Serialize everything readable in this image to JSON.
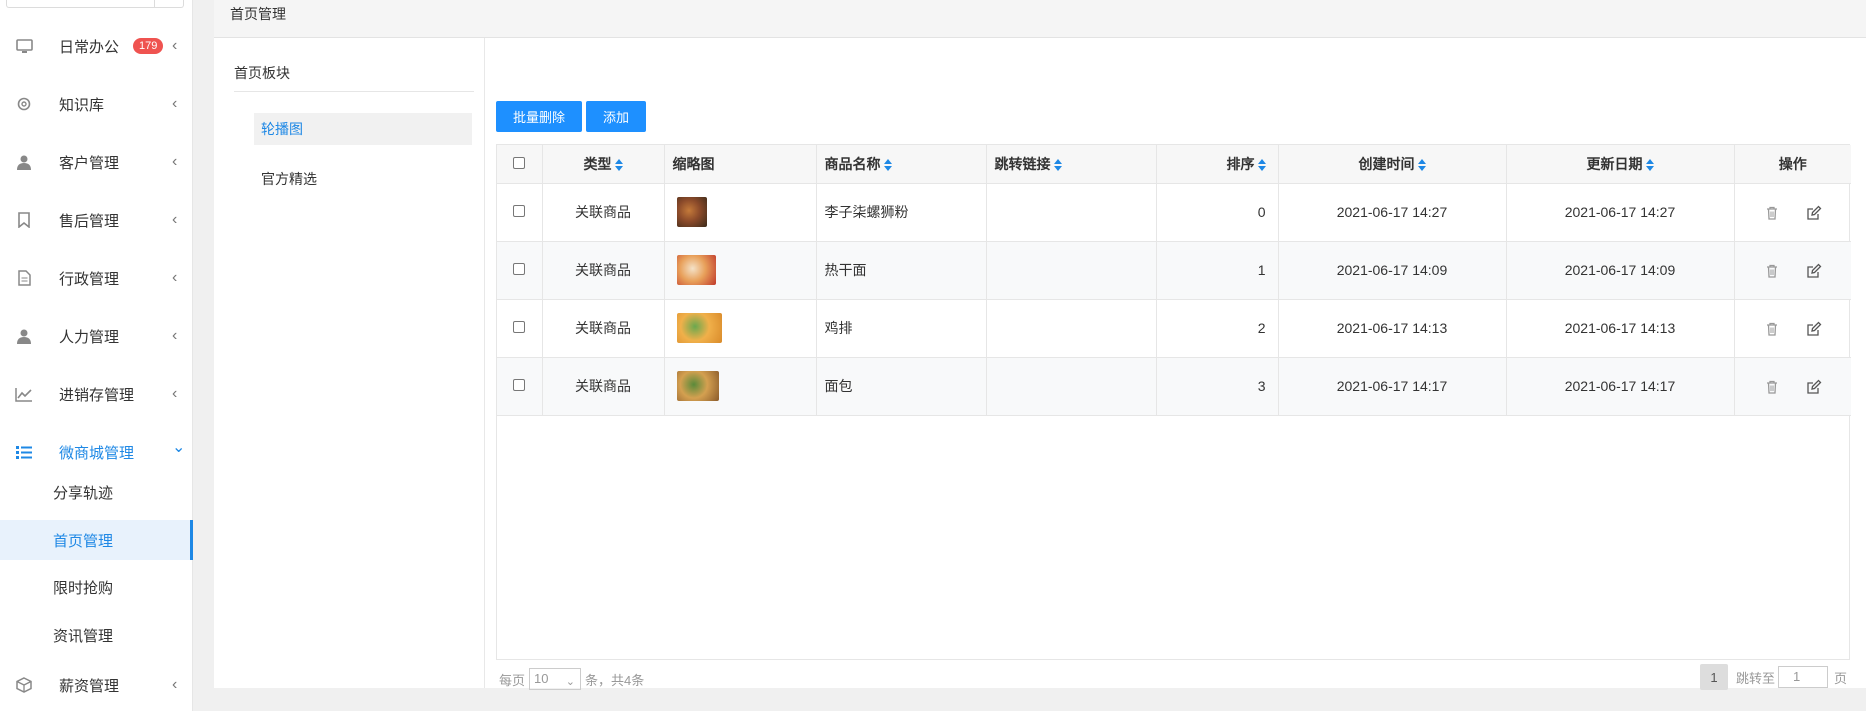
{
  "sidebar": {
    "menu": [
      {
        "label": "日常办公",
        "icon": "monitor-icon",
        "badge": "179"
      },
      {
        "label": "知识库",
        "icon": "gear-icon"
      },
      {
        "label": "客户管理",
        "icon": "user-icon"
      },
      {
        "label": "售后管理",
        "icon": "bookmark-icon"
      },
      {
        "label": "行政管理",
        "icon": "document-icon"
      },
      {
        "label": "人力管理",
        "icon": "user-icon"
      },
      {
        "label": "进销存管理",
        "icon": "line-chart-icon"
      },
      {
        "label": "微商城管理",
        "icon": "list-icon"
      },
      {
        "label": "薪资管理",
        "icon": "box-icon"
      }
    ],
    "submenu": [
      "分享轨迹",
      "首页管理",
      "限时抢购",
      "资讯管理"
    ],
    "chevron_closed": "‹",
    "chevron_open": "⌄"
  },
  "topbar": {
    "title": "首页管理"
  },
  "left_panel": {
    "title": "首页板块",
    "items": [
      "轮播图",
      "官方精选"
    ]
  },
  "toolbar": {
    "batch_delete": "批量删除",
    "add": "添加"
  },
  "table": {
    "headers": [
      "类型",
      "缩略图",
      "商品名称",
      "跳转链接",
      "排序",
      "创建时间",
      "更新日期",
      "操作"
    ],
    "rows": [
      {
        "type": "关联商品",
        "name": "李子柒螺狮粉",
        "link": "",
        "order": "0",
        "created": "2021-06-17 14:27",
        "updated": "2021-06-17 14:27",
        "thumb_colors": [
          "#3a2a1a",
          "#8b4a2a",
          "#c47a3a"
        ]
      },
      {
        "type": "关联商品",
        "name": "热干面",
        "link": "",
        "order": "1",
        "created": "2021-06-17 14:09",
        "updated": "2021-06-17 14:09",
        "thumb_colors": [
          "#c0392b",
          "#e8a05a",
          "#f4e2c8"
        ]
      },
      {
        "type": "关联商品",
        "name": "鸡排",
        "link": "",
        "order": "2",
        "created": "2021-06-17 14:13",
        "updated": "2021-06-17 14:13",
        "thumb_colors": [
          "#d98a2a",
          "#f0b04a",
          "#6aa84f"
        ]
      },
      {
        "type": "关联商品",
        "name": "面包",
        "link": "",
        "order": "3",
        "created": "2021-06-17 14:17",
        "updated": "2021-06-17 14:17",
        "thumb_colors": [
          "#8a5a2a",
          "#d4a050",
          "#5a8a3a"
        ]
      }
    ]
  },
  "pagination": {
    "per_page_prefix": "每页",
    "per_page_value": "10",
    "per_page_suffix": "条，共4条",
    "current_page": "1",
    "jump_prefix": "跳转至",
    "jump_value": "1",
    "jump_suffix": "页"
  },
  "colors": {
    "accent": "#1e88e5",
    "badge": "#ef5350",
    "button": "#1e90ff"
  }
}
